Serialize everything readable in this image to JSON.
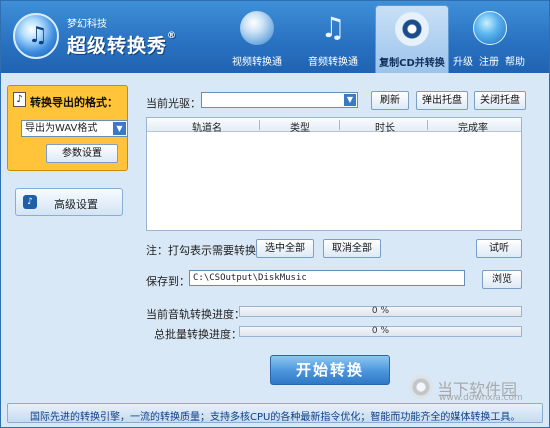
{
  "brand": {
    "company": "梦幻科技",
    "name": "超级转换秀",
    "reg": "®"
  },
  "nav": {
    "tabs": [
      {
        "label": "视频转换通",
        "icon": "film-reel-icon"
      },
      {
        "label": "音频转换通",
        "icon": "music-note-icon"
      },
      {
        "label": "复制CD并转换",
        "icon": "cd-disc-icon",
        "active": true
      }
    ],
    "links": [
      "升级",
      "注册",
      "帮助"
    ]
  },
  "sidebar": {
    "format_title": "转换导出的格式：",
    "format_selected": "导出为WAV格式",
    "param_button": "参数设置",
    "advanced_button": "高级设置"
  },
  "main": {
    "drive_label": "当前光驱：",
    "drive_value": "",
    "refresh_button": "刷新",
    "eject_button": "弹出托盘",
    "close_tray_button": "关闭托盘",
    "table_headers": [
      "轨道名",
      "类型",
      "时长",
      "完成率"
    ],
    "note": "注：打勾表示需要转换",
    "select_all_button": "选中全部",
    "deselect_all_button": "取消全部",
    "listen_button": "试听",
    "save_label": "保存到：",
    "save_path": "C:\\CSOutput\\DiskMusic",
    "browse_button": "浏览",
    "track_progress_label": "当前音轨转换进度：",
    "track_progress_text": "0 %",
    "track_progress": 0,
    "total_progress_label": "总批量转换进度：",
    "total_progress_text": "0 %",
    "total_progress": 0,
    "start_button": "开始转换"
  },
  "footer": {
    "text": "国际先进的转换引擎，一流的转换质量；支持多核CPU的各种最新指令优化；智能而功能齐全的媒体转换工具。"
  },
  "watermark": {
    "text": "当下软件园",
    "url": "www.downxia.com"
  },
  "colors": {
    "header": "#2a73c2",
    "format_panel": "#ffc43a",
    "accent": "#3a79c4"
  }
}
